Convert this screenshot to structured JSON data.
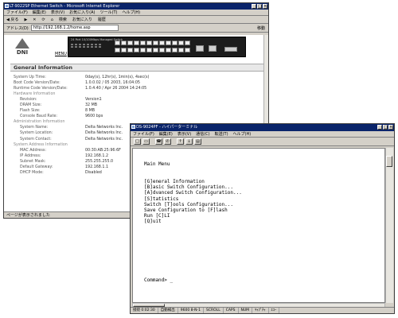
{
  "browser": {
    "title": "LT-9022SP Ethernet Switch - Microsoft Internet Explorer",
    "menu": [
      "ファイル(F)",
      "編集(E)",
      "表示(V)",
      "お気に入り(A)",
      "ツール(T)",
      "ヘルプ(H)"
    ],
    "toolbar": [
      "◀ 戻る",
      "▶",
      "✕",
      "⟳",
      "⌂",
      "検索",
      "お気に入り",
      "履歴"
    ],
    "address_label": "アドレス(D)",
    "address_value": "http://192.168.1.2/home.asp",
    "go_label": "移動",
    "status": "ページが表示されました"
  },
  "banner": {
    "logo_text": "DNI",
    "menu_link": "MENU",
    "switch_label": "24 Port 10/100Mbps Managed Switch"
  },
  "general_info": {
    "heading": "General Information",
    "rows": [
      {
        "label": "System Up Time:",
        "value": "0day(s), 12hr(s), 1min(s), 4sec(s)"
      },
      {
        "label": "Boot Code Version/Date:",
        "value": "1.0.0.02 / 05 2003, 16:04:05"
      },
      {
        "label": "Runtime Code Version/Date:",
        "value": "1.0.4.40 / Apr 26 2004 14:24:05"
      },
      {
        "label": "Hardware Information",
        "value": ""
      },
      {
        "label": "Revision:",
        "value": "Version1"
      },
      {
        "label": "DRAM Size:",
        "value": "32 MB"
      },
      {
        "label": "Flash Size:",
        "value": "8 MB"
      },
      {
        "label": "Console Baud Rate:",
        "value": "9600 bps"
      },
      {
        "label": "Administration Information",
        "value": ""
      },
      {
        "label": "System Name:",
        "value": "Delta Networks Inc."
      },
      {
        "label": "System Location:",
        "value": "Delta Networks Inc."
      },
      {
        "label": "System Contact:",
        "value": "Delta Networks Inc."
      },
      {
        "label": "System Address Information",
        "value": ""
      },
      {
        "label": "MAC Address:",
        "value": "00:30:AB:25:96:6F"
      },
      {
        "label": "IP Address:",
        "value": "192.168.1.2"
      },
      {
        "label": "Subnet Mask:",
        "value": "255.255.255.0"
      },
      {
        "label": "Default Gateway:",
        "value": "192.168.1.1"
      },
      {
        "label": "DHCP Mode:",
        "value": "Disabled"
      }
    ]
  },
  "terminal": {
    "title": "DS-9024PF - ハイパーターミナル",
    "menu": [
      "ファイル(F)",
      "編集(E)",
      "表示(V)",
      "通信(C)",
      "転送(T)",
      "ヘルプ(H)"
    ],
    "screen": {
      "title": "Main Menu",
      "items": [
        "[G]eneral Information",
        "[B]asic Switch Configuration...",
        "[A]dvanced Switch Configuration...",
        "[S]tatistics",
        "Switch [T]ools Configuration...",
        "Save Configuration to [F]lash",
        "Run [C]LI",
        "[Q]uit"
      ],
      "prompt": "Command> _"
    },
    "status": [
      "接続 0:02:30",
      "自動検出",
      "9600 8-N-1",
      "SCROLL",
      "CAPS",
      "NUM",
      "ｷｬﾌﾟﾁｬ",
      "ｴｺｰ"
    ]
  }
}
